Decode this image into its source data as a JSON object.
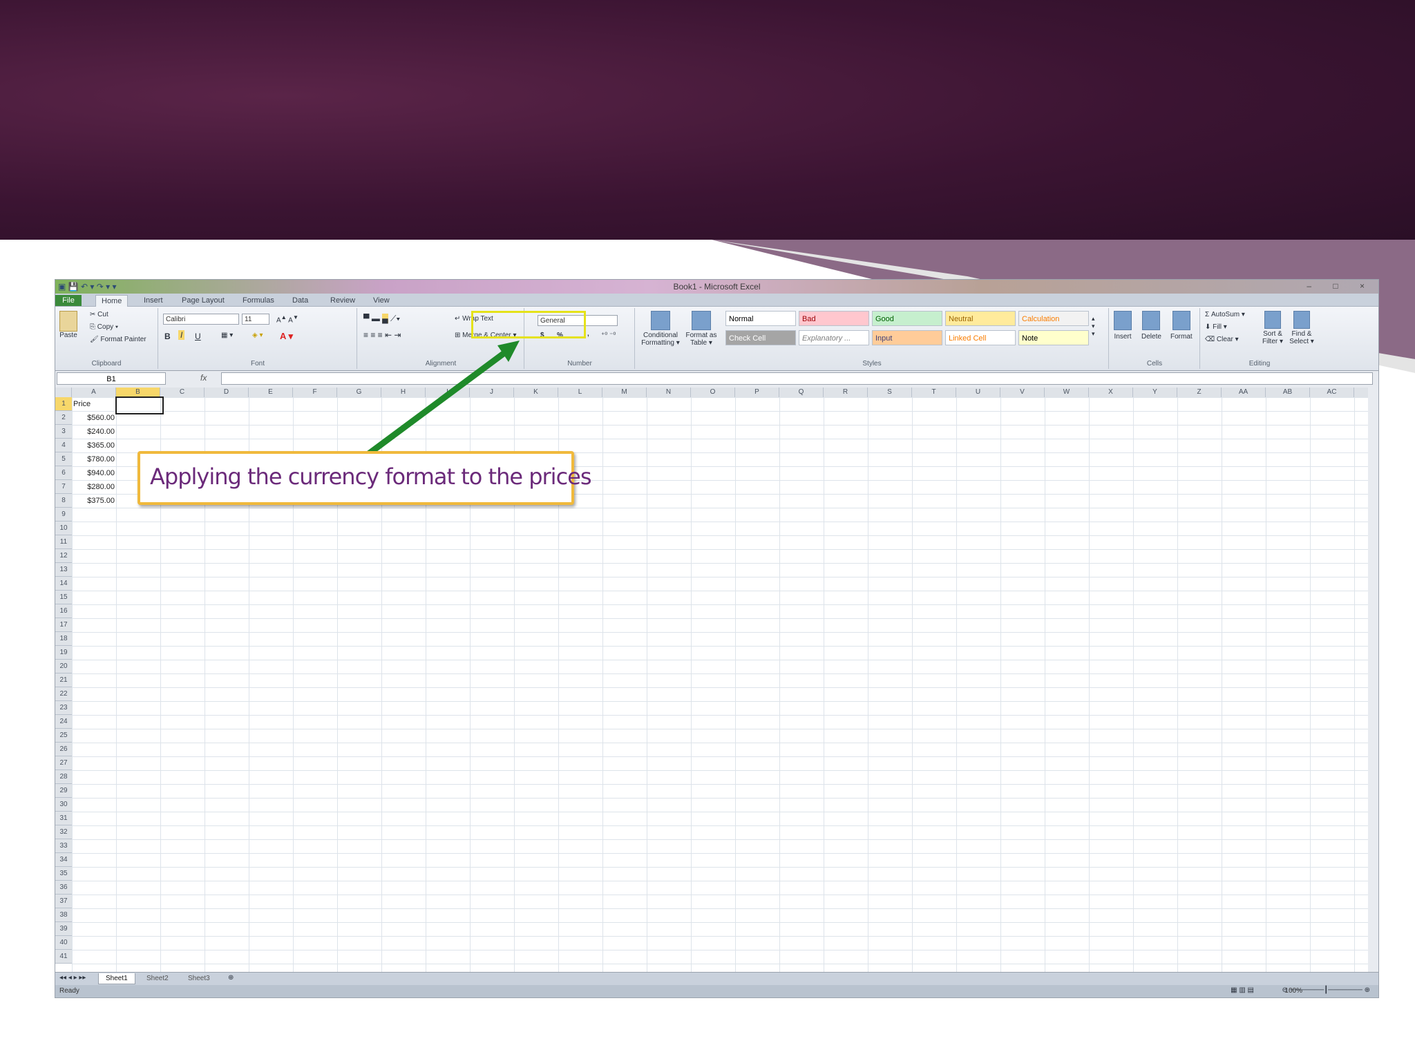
{
  "window": {
    "title": "Book1 - Microsoft Excel",
    "qat": "▣ 💾 ↶ ▾ ↷ ▾ ▾",
    "controls": "– □ ×"
  },
  "tabs": [
    "File",
    "Home",
    "Insert",
    "Page Layout",
    "Formulas",
    "Data",
    "Review",
    "View"
  ],
  "ribbon": {
    "clipboard": {
      "label": "Clipboard",
      "paste": "Paste",
      "cut": "Cut",
      "copy": "Copy ▾",
      "painter": "Format Painter"
    },
    "font": {
      "label": "Font",
      "name": "Calibri",
      "size": "11",
      "bold": "B",
      "italic": "I",
      "underline": "U"
    },
    "alignment": {
      "label": "Alignment",
      "wrap": "Wrap Text",
      "merge": "Merge & Center ▾"
    },
    "number": {
      "label": "Number",
      "format": "General",
      "currency": "$",
      "percent": "%",
      "comma": ","
    },
    "styles": {
      "label": "Styles",
      "conditional": "Conditional Formatting ▾",
      "format_table": "Format as Table ▾",
      "items": [
        "Normal",
        "Bad",
        "Good",
        "Neutral",
        "Calculation",
        "Check Cell",
        "Explanatory ...",
        "Input",
        "Linked Cell",
        "Note"
      ]
    },
    "cells": {
      "label": "Cells",
      "insert": "Insert",
      "delete": "Delete",
      "format": "Format"
    },
    "editing": {
      "label": "Editing",
      "autosum": "Σ AutoSum ▾",
      "fill": "Fill ▾",
      "clear": "Clear ▾",
      "sort": "Sort & Filter ▾",
      "find": "Find & Select ▾"
    }
  },
  "formula_bar": {
    "name_box": "B1",
    "fx": "fx",
    "value": ""
  },
  "grid": {
    "columns": [
      "A",
      "B",
      "C",
      "D",
      "E",
      "F",
      "G",
      "H",
      "I",
      "J",
      "K",
      "L",
      "M",
      "N",
      "O",
      "P",
      "Q",
      "R",
      "S",
      "T",
      "U",
      "V",
      "W",
      "X",
      "Y",
      "Z",
      "AA",
      "AB",
      "AC"
    ],
    "rows": [
      "1",
      "2",
      "3",
      "4",
      "5",
      "6",
      "7",
      "8",
      "9",
      "10",
      "11",
      "12",
      "13",
      "14",
      "15",
      "16",
      "17",
      "18",
      "19",
      "20",
      "21",
      "22",
      "23",
      "24",
      "25",
      "26",
      "27",
      "28",
      "29",
      "30",
      "31",
      "32",
      "33",
      "34",
      "35",
      "36",
      "37",
      "38",
      "39",
      "40",
      "41"
    ],
    "header_cell": "Price",
    "prices": [
      "$560.00",
      "$240.00",
      "$365.00",
      "$780.00",
      "$940.00",
      "$280.00",
      "$375.00"
    ]
  },
  "sheets": [
    "Sheet1",
    "Sheet2",
    "Sheet3"
  ],
  "status": {
    "ready": "Ready",
    "zoom": "100%"
  },
  "callout": {
    "text": "Applying the currency format to the prices"
  },
  "colors": {
    "banner": "#3b1432",
    "callout_border": "#f0b93c",
    "callout_text": "#6b2a7a",
    "highlight": "#e5e21a",
    "arrow": "#1f8a2a"
  }
}
